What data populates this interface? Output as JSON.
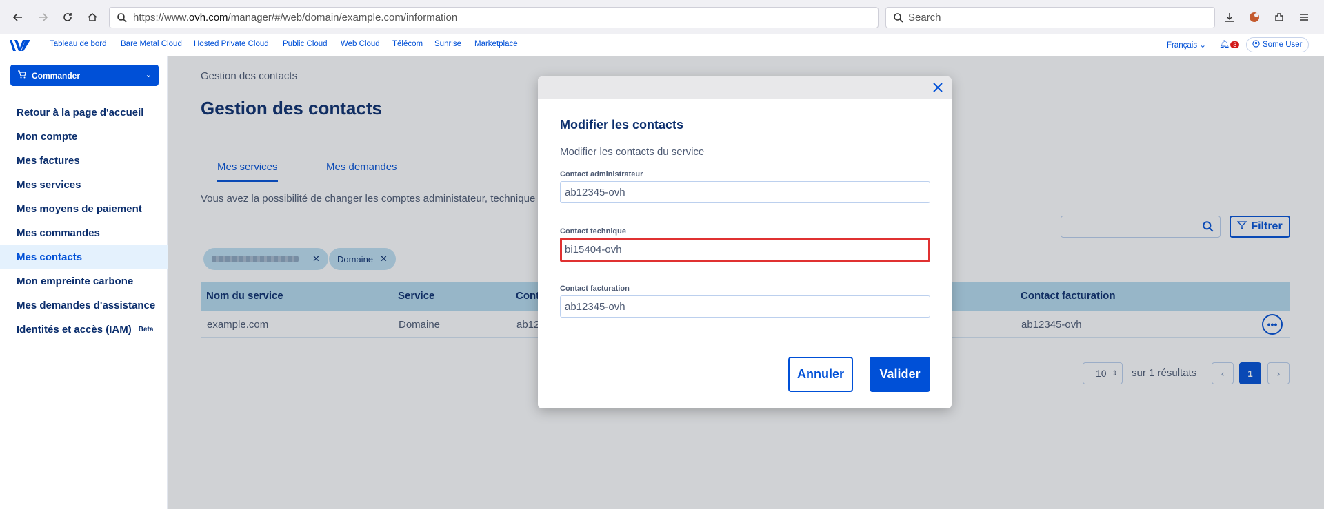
{
  "browser": {
    "url_prefix": "https://www.",
    "url_host": "ovh.com",
    "url_path": "/manager/#/web/domain/example.com/information",
    "search_placeholder": "Search"
  },
  "topnav": {
    "items": [
      "Tableau de bord",
      "Bare Metal Cloud",
      "Hosted Private Cloud",
      "Public Cloud",
      "Web Cloud",
      "Télécom",
      "Sunrise",
      "Marketplace"
    ],
    "language": "Français",
    "notifications_count": "3",
    "user": "Some User"
  },
  "sidebar": {
    "order_button": "Commander",
    "items": [
      {
        "label": "Retour à la page d'accueil"
      },
      {
        "label": "Mon compte"
      },
      {
        "label": "Mes factures"
      },
      {
        "label": "Mes services"
      },
      {
        "label": "Mes moyens de paiement"
      },
      {
        "label": "Mes commandes"
      },
      {
        "label": "Mes contacts"
      },
      {
        "label": "Mon empreinte carbone"
      },
      {
        "label": "Mes demandes d'assistance"
      },
      {
        "label": "Identités et accès (IAM)"
      }
    ],
    "beta_badge": "Beta"
  },
  "page": {
    "breadcrumb": "Gestion des contacts",
    "title": "Gestion des contacts",
    "tabs": [
      "Mes services",
      "Mes demandes"
    ],
    "description": "Vous avez la possibilité de changer les comptes administateur, technique",
    "filter_button": "Filtrer",
    "chips": [
      "",
      "Domaine"
    ],
    "table": {
      "headers": [
        "Nom du service",
        "Service",
        "Cont",
        "Contact facturation"
      ],
      "rows": [
        {
          "name": "example.com",
          "service": "Domaine",
          "contact": "ab12",
          "billing": "ab12345-ovh"
        }
      ]
    },
    "pagination": {
      "page_size": "10",
      "results": "sur 1 résultats",
      "current_page": "1"
    }
  },
  "modal": {
    "title": "Modifier les contacts",
    "subtitle": "Modifier les contacts du service",
    "fields": {
      "admin": {
        "label": "Contact administrateur",
        "value": "ab12345-ovh"
      },
      "tech": {
        "label": "Contact technique",
        "value": "bi15404-ovh"
      },
      "billing": {
        "label": "Contact facturation",
        "value": "ab12345-ovh"
      }
    },
    "cancel_label": "Annuler",
    "submit_label": "Valider"
  }
}
